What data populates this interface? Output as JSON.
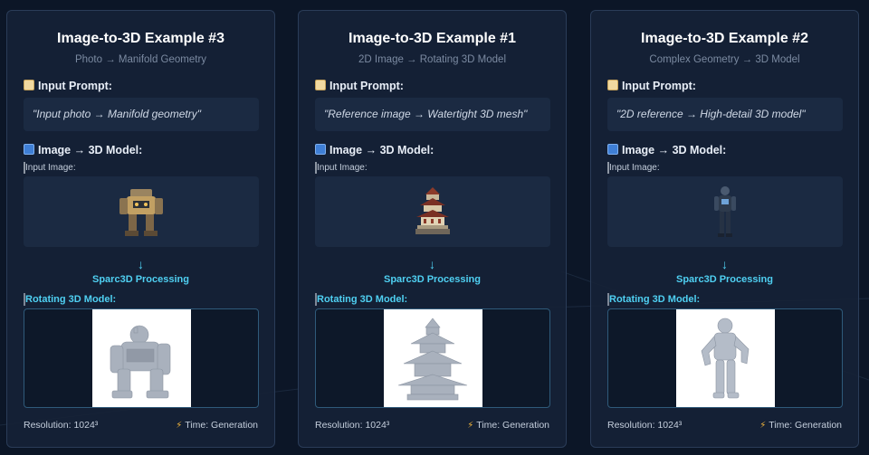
{
  "cards": [
    {
      "title": "Image-to-3D Example #3",
      "subtitle": "Photo → Manifold Geometry",
      "prompt_label": "Input Prompt:",
      "prompt": "\"Input photo → Manifold geometry\"",
      "section_label": "Image → 3D Model:",
      "input_label": "Input Image:",
      "arrow": "↓",
      "processing": "Sparc3D Processing",
      "model_label": "Rotating 3D Model:",
      "resolution": "Resolution: 1024³",
      "time": "Time: Generation"
    },
    {
      "title": "Image-to-3D Example #1",
      "subtitle": "2D Image → Rotating 3D Model",
      "prompt_label": "Input Prompt:",
      "prompt": "\"Reference image → Watertight 3D mesh\"",
      "section_label": "Image → 3D Model:",
      "input_label": "Input Image:",
      "arrow": "↓",
      "processing": "Sparc3D Processing",
      "model_label": "Rotating 3D Model:",
      "resolution": "Resolution: 1024³",
      "time": "Time: Generation"
    },
    {
      "title": "Image-to-3D Example #2",
      "subtitle": "Complex Geometry → 3D Model",
      "prompt_label": "Input Prompt:",
      "prompt": "\"2D reference → High-detail 3D model\"",
      "section_label": "Image → 3D Model:",
      "input_label": "Input Image:",
      "arrow": "↓",
      "processing": "Sparc3D Processing",
      "model_label": "Rotating 3D Model:",
      "resolution": "Resolution: 1024³",
      "time": "Time: Generation"
    }
  ],
  "colors": {
    "background": "#0c1627",
    "card": "#162236",
    "accent": "#4fd0f2",
    "muted": "#7b8aa1"
  },
  "icons": [
    "memo-icon",
    "cycle-icon",
    "camera-icon",
    "film-icon",
    "magnifier-icon",
    "lightning-icon"
  ]
}
